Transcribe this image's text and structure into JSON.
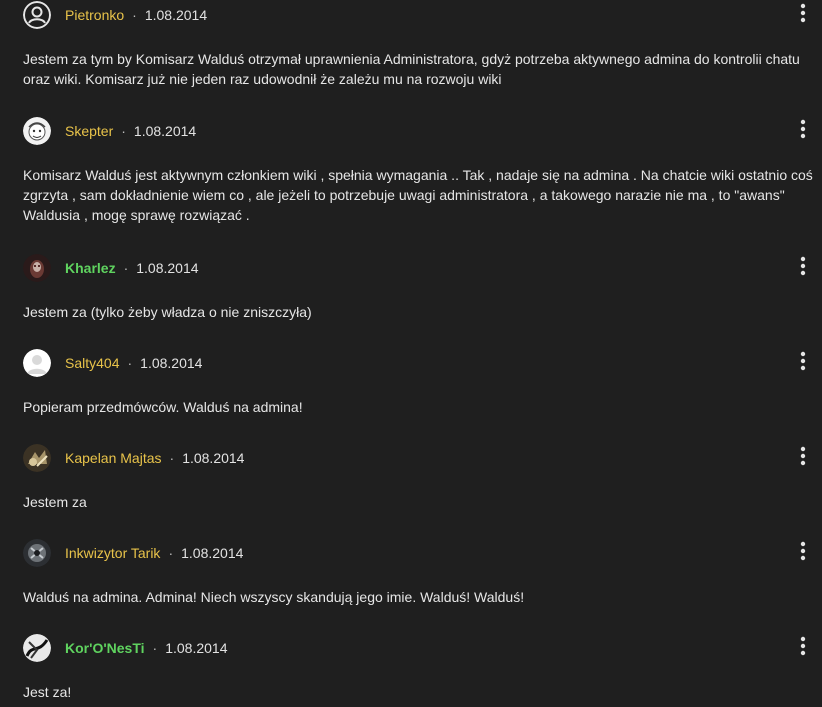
{
  "comments": [
    {
      "author": "Pietronko",
      "date": "1.08.2014",
      "text": "Jestem za tym by Komisarz Walduś otrzymał uprawnienia Administratora, gdyż potrzeba aktywnego admina do kontrolii chatu oraz wiki. Komisarz już nie jeden raz udowodnił że zależu mu na rozwoju wiki",
      "avatar": "default-user-icon"
    },
    {
      "author": "Skepter",
      "date": "1.08.2014",
      "text": "Komisarz Walduś jest aktywnym członkiem wiki , spełnia wymagania .. Tak , nadaje się na admina . Na chatcie wiki ostatnio coś zgrzyta , sam dokładnienie wiem co , ale jeżeli to potrzebuje uwagi administratora , a takowego narazie nie ma , to \"awans\" Waldusia , mogę sprawę rozwiązać .",
      "avatar": "cartoon-face-avatar"
    },
    {
      "author": "Kharlez",
      "date": "1.08.2014",
      "text": "Jestem za (tylko żeby władza o nie zniszczyła)",
      "avatar": "dark-face-avatar"
    },
    {
      "author": "Salty404",
      "date": "1.08.2014",
      "text": "Popieram przedmówców. Walduś na admina!",
      "avatar": "blank-avatar"
    },
    {
      "author": "Kapelan Majtas",
      "date": "1.08.2014",
      "text": "Jestem za",
      "avatar": "sepia-avatar"
    },
    {
      "author": "Inkwizytor Tarik",
      "date": "1.08.2014",
      "text": "Walduś na admina. Admina! Niech wszyscy skandują jego imie. Walduś! Walduś!",
      "avatar": "mechanical-avatar"
    },
    {
      "author": "Kor'O'NesTi",
      "date": "1.08.2014",
      "text": "Jest za!",
      "avatar": "sketch-avatar"
    }
  ],
  "colors": {
    "background": "#1f1f1f",
    "author": "#e8c34a",
    "author_staff": "#5fd35f",
    "text": "#e6e6e6"
  },
  "icons": {
    "menu": "more-vertical-icon",
    "separator": "·"
  }
}
